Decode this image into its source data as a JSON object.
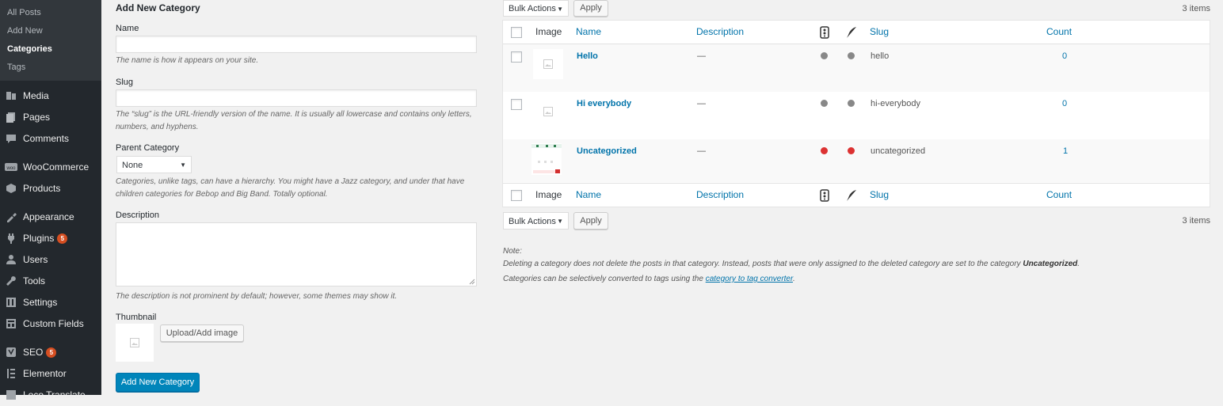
{
  "sidebar": {
    "submenu": [
      "All Posts",
      "Add New",
      "Categories",
      "Tags"
    ],
    "current_submenu": "Categories",
    "menu": [
      {
        "label": "Media",
        "icon": "media-icon"
      },
      {
        "label": "Pages",
        "icon": "pages-icon"
      },
      {
        "label": "Comments",
        "icon": "comments-icon"
      },
      {
        "label": "WooCommerce",
        "icon": "woocommerce-icon"
      },
      {
        "label": "Products",
        "icon": "products-icon"
      },
      {
        "label": "Appearance",
        "icon": "appearance-icon"
      },
      {
        "label": "Plugins",
        "icon": "plugins-icon",
        "badge": "5"
      },
      {
        "label": "Users",
        "icon": "users-icon"
      },
      {
        "label": "Tools",
        "icon": "tools-icon"
      },
      {
        "label": "Settings",
        "icon": "settings-icon"
      },
      {
        "label": "Custom Fields",
        "icon": "custom-fields-icon"
      },
      {
        "label": "SEO",
        "icon": "seo-icon",
        "badge": "5"
      },
      {
        "label": "Elementor",
        "icon": "elementor-icon"
      },
      {
        "label": "Loco Translate",
        "icon": "translate-icon"
      }
    ]
  },
  "form": {
    "title": "Add New Category",
    "name_label": "Name",
    "name_value": "",
    "name_hint": "The name is how it appears on your site.",
    "slug_label": "Slug",
    "slug_value": "",
    "slug_hint": "The “slug” is the URL-friendly version of the name. It is usually all lowercase and contains only letters, numbers, and hyphens.",
    "parent_label": "Parent Category",
    "parent_value": "None",
    "parent_hint": "Categories, unlike tags, can have a hierarchy. You might have a Jazz category, and under that have children categories for Bebop and Big Band. Totally optional.",
    "description_label": "Description",
    "description_value": "",
    "description_hint": "The description is not prominent by default; however, some themes may show it.",
    "thumbnail_label": "Thumbnail",
    "upload_button": "Upload/Add image",
    "submit_button": "Add New Category"
  },
  "table_nav": {
    "bulk_actions": "Bulk Actions",
    "apply": "Apply",
    "items_count": "3 items"
  },
  "table": {
    "columns": {
      "image": "Image",
      "name": "Name",
      "description": "Description",
      "slug": "Slug",
      "count": "Count"
    },
    "rows": [
      {
        "name": "Hello",
        "description": "—",
        "slug": "hello",
        "count": "0",
        "status1": "#888888",
        "status2": "#888888"
      },
      {
        "name": "Hi everybody",
        "description": "—",
        "slug": "hi-everybody",
        "count": "0",
        "status1": "#888888",
        "status2": "#888888"
      },
      {
        "name": "Uncategorized",
        "description": "—",
        "slug": "uncategorized",
        "count": "1",
        "status1": "#dc3232",
        "status2": "#dc3232"
      }
    ]
  },
  "note": {
    "heading": "Note:",
    "line1_prefix": "Deleting a category does not delete the posts in that category. Instead, posts that were only assigned to the deleted category are set to the category ",
    "line1_bold": "Uncategorized",
    "line1_suffix": ".",
    "line2_prefix": "Categories can be selectively converted to tags using the ",
    "line2_link": "category to tag converter",
    "line2_suffix": "."
  },
  "colors": {
    "accent": "#0073aa",
    "primary_button": "#0085ba",
    "sidebar": "#23282d",
    "badge": "#d54e21"
  }
}
